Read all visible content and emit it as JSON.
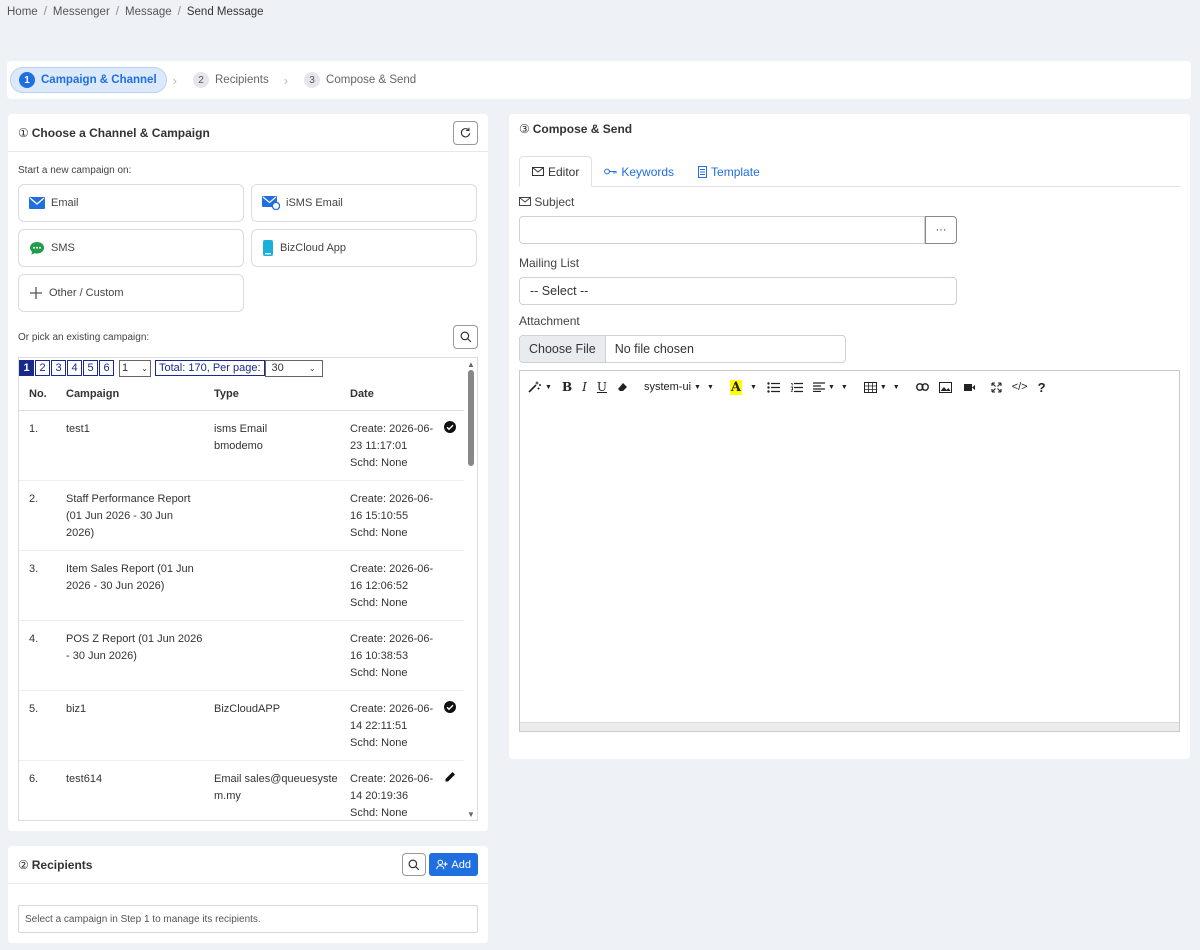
{
  "breadcrumb": [
    "Home",
    "Messenger",
    "Message",
    "Send Message"
  ],
  "stepper": [
    {
      "num": "1",
      "label": "Campaign & Channel"
    },
    {
      "num": "2",
      "label": "Recipients"
    },
    {
      "num": "3",
      "label": "Compose & Send"
    }
  ],
  "campaign_card": {
    "title_num": "①",
    "title": "Choose a Channel & Campaign",
    "new_label": "Start a new campaign on:",
    "channels": [
      "Email",
      "iSMS Email",
      "SMS",
      "BizCloud App",
      "Other / Custom"
    ],
    "existing_label": "Or pick an existing campaign:",
    "pager": {
      "pages": [
        "1",
        "2",
        "3",
        "4",
        "5",
        "6"
      ],
      "page_select": "1",
      "total": "Total: 170, Per page:",
      "per_page": "30"
    },
    "columns": [
      "No.",
      "Campaign",
      "Type",
      "Date"
    ],
    "rows": [
      {
        "no": "1.",
        "campaign": "test1",
        "type": "isms Email bmodemo",
        "date": "Create: 2026-06-23 11:17:01 Schd: None",
        "status": "check"
      },
      {
        "no": "2.",
        "campaign": "Staff Performance Report (01 Jun 2026 - 30 Jun 2026)",
        "type": "",
        "date": "Create: 2026-06-16 15:10:55 Schd: None",
        "status": ""
      },
      {
        "no": "3.",
        "campaign": "Item Sales Report (01 Jun 2026 - 30 Jun 2026)",
        "type": "",
        "date": "Create: 2026-06-16 12:06:52 Schd: None",
        "status": ""
      },
      {
        "no": "4.",
        "campaign": "POS Z Report (01 Jun 2026 - 30 Jun 2026)",
        "type": "",
        "date": "Create: 2026-06-16 10:38:53 Schd: None",
        "status": ""
      },
      {
        "no": "5.",
        "campaign": "biz1",
        "type": "BizCloudAPP",
        "date": "Create: 2026-06-14 22:11:51 Schd: None",
        "status": "check"
      },
      {
        "no": "6.",
        "campaign": "test614",
        "type": "Email sales@queuesystem.my",
        "date": "Create: 2026-06-14 20:19:36 Schd: None",
        "status": "edit"
      }
    ]
  },
  "recipients_card": {
    "title_num": "②",
    "title": "Recipients",
    "add_label": "Add",
    "note": "Select a campaign in Step 1 to manage its recipients."
  },
  "compose_card": {
    "title_num": "③",
    "title": "Compose & Send",
    "tabs": [
      "Editor",
      "Keywords",
      "Template"
    ],
    "subject_label": "Subject",
    "subject_value": "",
    "subject_more": "···",
    "mailing_label": "Mailing List",
    "mailing_value": "-- Select --",
    "attachment_label": "Attachment",
    "choose_file": "Choose File",
    "no_file": "No file chosen",
    "font_select": "system-ui"
  },
  "colors": {
    "accent": "#1f6fe0",
    "pager": "#1a2a8a",
    "background": "#eef1f5"
  }
}
